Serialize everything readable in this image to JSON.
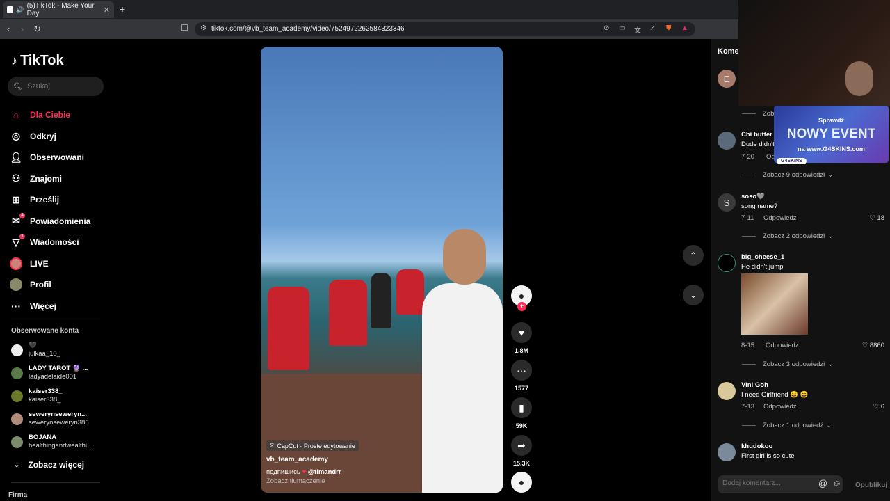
{
  "browser": {
    "tab_title": "(5)TikTok - Make Your Day",
    "url": "tiktok.com/@vb_team_academy/video/7524972262584323346"
  },
  "sidebar": {
    "logo": "TikTok",
    "search_placeholder": "Szukaj",
    "nav": [
      {
        "label": "Dla Ciebie",
        "icon": "home-icon"
      },
      {
        "label": "Odkryj",
        "icon": "compass-icon"
      },
      {
        "label": "Obserwowani",
        "icon": "following-icon"
      },
      {
        "label": "Znajomi",
        "icon": "friends-icon"
      },
      {
        "label": "Prześlij",
        "icon": "upload-icon"
      },
      {
        "label": "Powiadomienia",
        "icon": "notification-icon",
        "badge": "4"
      },
      {
        "label": "Wiadomości",
        "icon": "message-icon",
        "badge": "1"
      },
      {
        "label": "LIVE",
        "icon": "live-icon"
      },
      {
        "label": "Profil",
        "icon": "profile-icon"
      },
      {
        "label": "Więcej",
        "icon": "more-icon"
      }
    ],
    "followed_title": "Obserwowane konta",
    "followed": [
      {
        "name": "🖤",
        "user": "julkaa_10_"
      },
      {
        "name": "LADY TAROT 🔮 ...",
        "user": "ladyadelaide001"
      },
      {
        "name": "kaiser338_",
        "user": "kaiser338_"
      },
      {
        "name": "sewerynseweryn...",
        "user": "sewerynseweryn386"
      },
      {
        "name": "BOJANA",
        "user": "healthingandwealthi..."
      }
    ],
    "see_more": "Zobacz więcej",
    "footer": "Firma"
  },
  "video": {
    "capcut": "CapCut · Proste edytowanie",
    "author": "vb_team_academy",
    "desc_prefix": "подпишись",
    "desc_mention": "@timandrr",
    "translate": "Zobacz tłumaczenie",
    "likes": "1.8M",
    "comments": "1577",
    "saves": "59K",
    "shares": "15.3K"
  },
  "comments": {
    "title": "Komentarze",
    "items": [
      {
        "avatar_letter": "E",
        "name": "",
        "text": "",
        "date": "",
        "likes": ""
      },
      {
        "name": "Chi butter",
        "text": "Dude didn't",
        "date": "7-20",
        "reply": "Odpowiedz",
        "likes": "",
        "see_replies": "Zobacz 9 odpowiedzi"
      },
      {
        "avatar_letter": "S",
        "name": "soso🩶",
        "text": "song name?",
        "date": "7-11",
        "reply": "Odpowiedz",
        "likes": "18",
        "see_replies": "Zobacz 2 odpowiedzi"
      },
      {
        "name": "big_cheese_1",
        "text": "He didn't jump",
        "date": "8-15",
        "reply": "Odpowiedz",
        "likes": "8860",
        "see_replies": "Zobacz 3 odpowiedzi"
      },
      {
        "name": "Vini Goh",
        "text": "I need Girlfriend 😄 😄",
        "date": "7-13",
        "reply": "Odpowiedz",
        "likes": "6",
        "see_replies": "Zobacz 1 odpowiedź"
      },
      {
        "name": "khudokoo",
        "text": "First girl is so cute"
      }
    ],
    "first_see": "Zobacz",
    "input_placeholder": "Dodaj komentarz...",
    "publish": "Opublikuj"
  },
  "overlay_ad": {
    "line1": "Sprawdź",
    "line2": "NOWY EVENT",
    "line3": "na www.G4SKINS.com",
    "brand": "G4SKINS"
  },
  "colors": {
    "accent": "#fe2c55",
    "bg": "#000000",
    "panel": "#121212"
  }
}
